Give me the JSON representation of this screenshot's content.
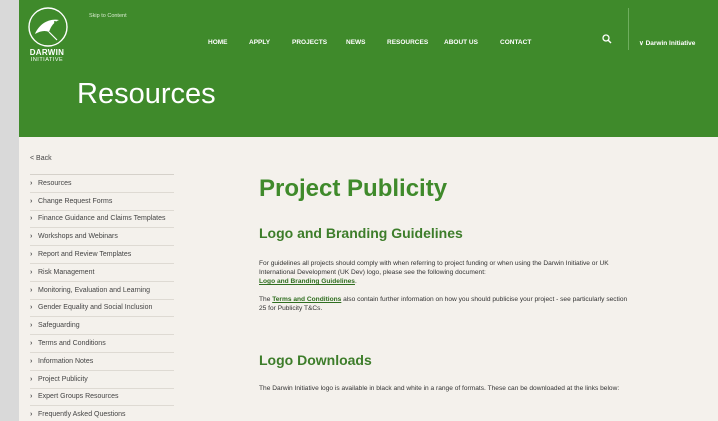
{
  "header": {
    "skip_link": "Skip to Content",
    "logo_line1": "DARWIN",
    "logo_line2": "INITIATIVE",
    "nav": [
      "HOME",
      "APPLY",
      "PROJECTS",
      "NEWS",
      "RESOURCES",
      "ABOUT US",
      "CONTACT"
    ],
    "search_icon": "search-icon",
    "brand_dropdown": "∨ Darwin Initiative",
    "hero_title": "Resources",
    "colors": {
      "header_bg": "#3f8a2b",
      "heading": "#3f8a2b",
      "page_bg": "#f4f1ec"
    }
  },
  "sidebar": {
    "back_label": "< Back",
    "items": [
      "Resources",
      "Change Request Forms",
      "Finance Guidance and Claims Templates",
      "Workshops and Webinars",
      "Report and Review Templates",
      "Risk Management",
      "Monitoring, Evaluation and Learning",
      "Gender Equality and Social Inclusion",
      "Safeguarding",
      "Terms and Conditions",
      "Information Notes",
      "Project Publicity",
      "Expert Groups Resources",
      "Frequently Asked Questions"
    ]
  },
  "main": {
    "title": "Project Publicity",
    "section1_heading": "Logo and Branding Guidelines",
    "para1_text": "For guidelines all projects should comply with when referring to project funding or when using the Darwin Initiative or UK International Development (UK Dev) logo, please see the following document:",
    "para1_link": "Logo and Branding Guidelines",
    "para1_end": ".",
    "para2_pre": "The ",
    "para2_link": "Terms and Conditions",
    "para2_text": " also contain further information on how you should publicise your project - see particularly section 25 for Publicity T&Cs.",
    "section2_heading": "Logo Downloads",
    "para3_text": "The Darwin Initiative logo is available in black and white in a range of formats. These can be downloaded at the links below:"
  }
}
